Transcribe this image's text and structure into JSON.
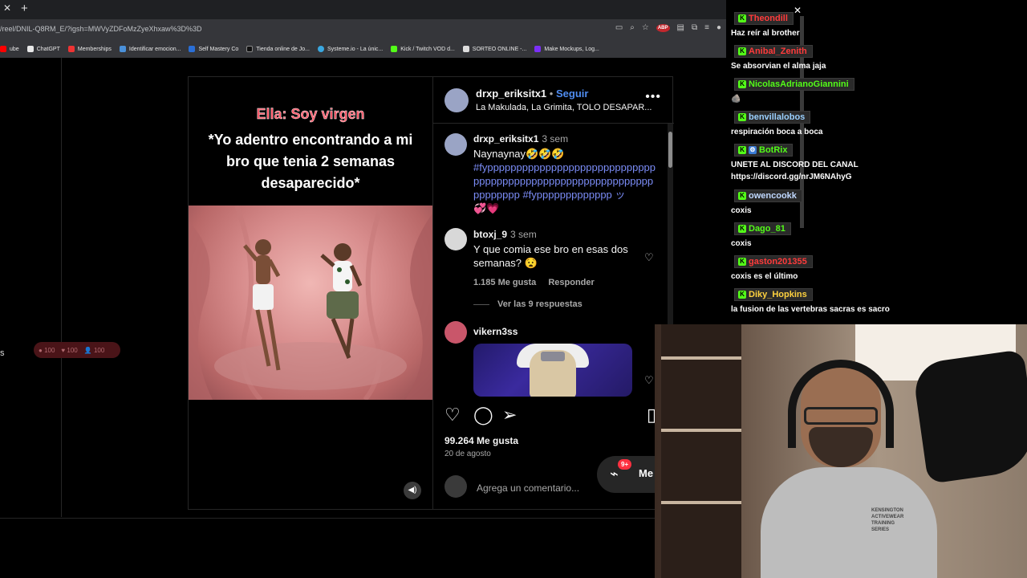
{
  "browser": {
    "url": "/reel/DNIL-Q8RM_E/?igsh=MWVyZDFoMzZyeXhxaw%3D%3D",
    "bookmarks": [
      {
        "label": "ube",
        "color": "#ff0000"
      },
      {
        "label": "ChatGPT",
        "color": "#e8e8e8"
      },
      {
        "label": "Memberships",
        "color": "#e33"
      },
      {
        "label": "Identificar emocion...",
        "color": "#4a90d9"
      },
      {
        "label": "Self Mastery Co",
        "color": "#2a6fd6"
      },
      {
        "label": "Tienda online de Jo...",
        "color": "#222"
      },
      {
        "label": "Systeme.io - La únic...",
        "color": "#3aa7e0"
      },
      {
        "label": "Kick / Twitch VOD d...",
        "color": "#53fc18"
      },
      {
        "label": "SORTEO ONLINE -...",
        "color": "#ddd"
      },
      {
        "label": "Make Mockups, Log...",
        "color": "#7b2ff7"
      }
    ]
  },
  "left_stats": {
    "edge_text": "s",
    "a": "100",
    "b": "100",
    "c": "100"
  },
  "reel": {
    "caption_line1": "Ella: Soy virgen",
    "caption_line2": "*Yo adentro encontrando a mi bro que tenia 2 semanas desaparecido*",
    "header": {
      "username": "drxp_eriksitx1",
      "dot": "•",
      "follow": "Seguir",
      "audio": "La Makulada, La Grimita, TOLO DESAPAR..."
    },
    "comments": [
      {
        "user": "drxp_eriksitx1",
        "time": "3 sem",
        "text": "Naynaynay🤣🤣🤣",
        "hashtags": "#fypppppppppppppppppppppppppppppppppppppppppppppppppppppppppppppppppppp #fyppppppppppppp ッ",
        "emoji": "💞💗"
      },
      {
        "user": "btoxj_9",
        "time": "3 sem",
        "text": "Y que comia ese bro en esas dos semanas? 😧",
        "likes": "1.185 Me gusta",
        "reply": "Responder",
        "view_replies": "Ver las 9 respuestas"
      },
      {
        "user": "vikern3ss"
      }
    ],
    "likes": "99.264 Me gusta",
    "date": "20 de agosto",
    "add_comment_placeholder": "Agrega un comentario...",
    "messages_badge": "9+",
    "messages_label": "Me"
  },
  "chat": [
    {
      "user": "Theondill",
      "color": "#ff3b3b",
      "text": "Haz reír al brother"
    },
    {
      "user": "Anibal_Zenith",
      "color": "#ff3b3b",
      "text": "Se absorvian el alma jaja"
    },
    {
      "user": "NicolasAdrianoGiannini",
      "color": "#53fc18",
      "text": "🪨"
    },
    {
      "user": "benvillalobos",
      "color": "#9ad0ff",
      "text": "respiración boca a boca"
    },
    {
      "user": "BotRix",
      "color": "#53fc18",
      "text": "UNETE AL DISCORD DEL CANAL https://discord.gg/nrJM6NAhyG"
    },
    {
      "user": "owencookk",
      "color": "#c0d8ff",
      "text": "coxis"
    },
    {
      "user": "Dago_81",
      "color": "#53fc18",
      "text": "coxis"
    },
    {
      "user": "gaston201355",
      "color": "#ff3b3b",
      "text": "coxis es el último"
    },
    {
      "user": "Diky_Hopkins",
      "color": "#ffd23f",
      "text": "la fusion de las vertebras sacras es sacro"
    }
  ],
  "webcam": {
    "hoodie_text": "KENSINGTON ACTIVEWEAR TRAINING SERIES"
  }
}
